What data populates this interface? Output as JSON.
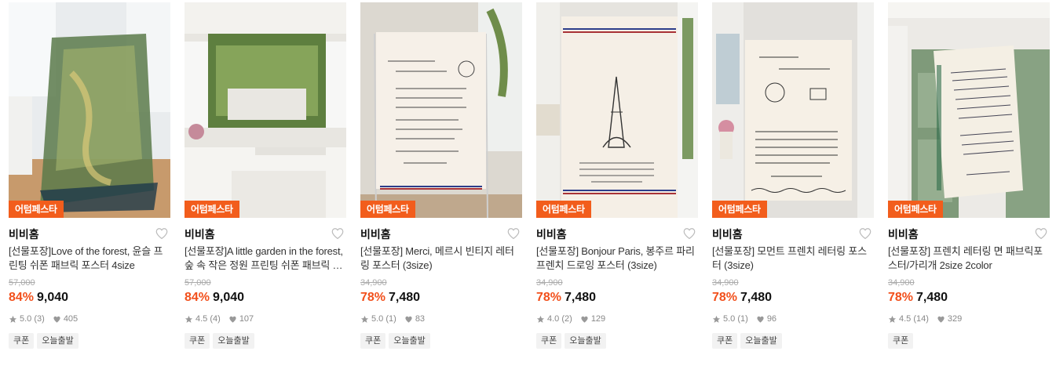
{
  "products": [
    {
      "badge": "어텀페스타",
      "shop": "비비홈",
      "title": "[선물포장]Love of the forest, 윤슬 프린팅 쉬폰 패브릭 포스터 4size",
      "original_price": "57,000",
      "discount": "84%",
      "price": "9,040",
      "rating": "5.0",
      "review_count": "(3)",
      "likes": "405",
      "tags": [
        "쿠폰",
        "오늘출발"
      ],
      "image_icon": "forest-chiffon-poster-image"
    },
    {
      "badge": "어텀페스타",
      "shop": "비비홈",
      "title": "[선물포장]A little garden in the forest, 숲 속 작은 정원 프린팅 쉬폰 패브릭 포스터",
      "original_price": "57,000",
      "discount": "84%",
      "price": "9,040",
      "rating": "4.5",
      "review_count": "(4)",
      "likes": "107",
      "tags": [
        "쿠폰",
        "오늘출발"
      ],
      "image_icon": "garden-poster-image"
    },
    {
      "badge": "어텀페스타",
      "shop": "비비홈",
      "title": "[선물포장] Merci, 메르시 빈티지 레터링 포스터 (3size)",
      "original_price": "34,900",
      "discount": "78%",
      "price": "7,480",
      "rating": "5.0",
      "review_count": "(1)",
      "likes": "83",
      "tags": [
        "쿠폰",
        "오늘출발"
      ],
      "image_icon": "merci-lettering-poster-image"
    },
    {
      "badge": "어텀페스타",
      "shop": "비비홈",
      "title": "[선물포장] Bonjour Paris, 봉주르 파리 프렌치 드로잉 포스터 (3size)",
      "original_price": "34,900",
      "discount": "78%",
      "price": "7,480",
      "rating": "4.0",
      "review_count": "(2)",
      "likes": "129",
      "tags": [
        "쿠폰",
        "오늘출발"
      ],
      "image_icon": "bonjour-paris-poster-image"
    },
    {
      "badge": "어텀페스타",
      "shop": "비비홈",
      "title": "[선물포장] 모먼트 프렌치 레터링 포스터 (3size)",
      "original_price": "34,900",
      "discount": "78%",
      "price": "7,480",
      "rating": "5.0",
      "review_count": "(1)",
      "likes": "96",
      "tags": [
        "쿠폰",
        "오늘출발"
      ],
      "image_icon": "moment-lettering-poster-image"
    },
    {
      "badge": "어텀페스타",
      "shop": "비비홈",
      "title": "[선물포장] 프렌치 레터링 면 패브릭포스터/가리개 2size 2color",
      "original_price": "34,900",
      "discount": "78%",
      "price": "7,480",
      "rating": "4.5",
      "review_count": "(14)",
      "likes": "329",
      "tags": [
        "쿠폰"
      ],
      "image_icon": "french-lettering-fabric-image"
    }
  ],
  "colors": {
    "badge_bg": "#f25d1c",
    "discount": "#f2501c",
    "tag_bg": "#f2f2f2"
  }
}
